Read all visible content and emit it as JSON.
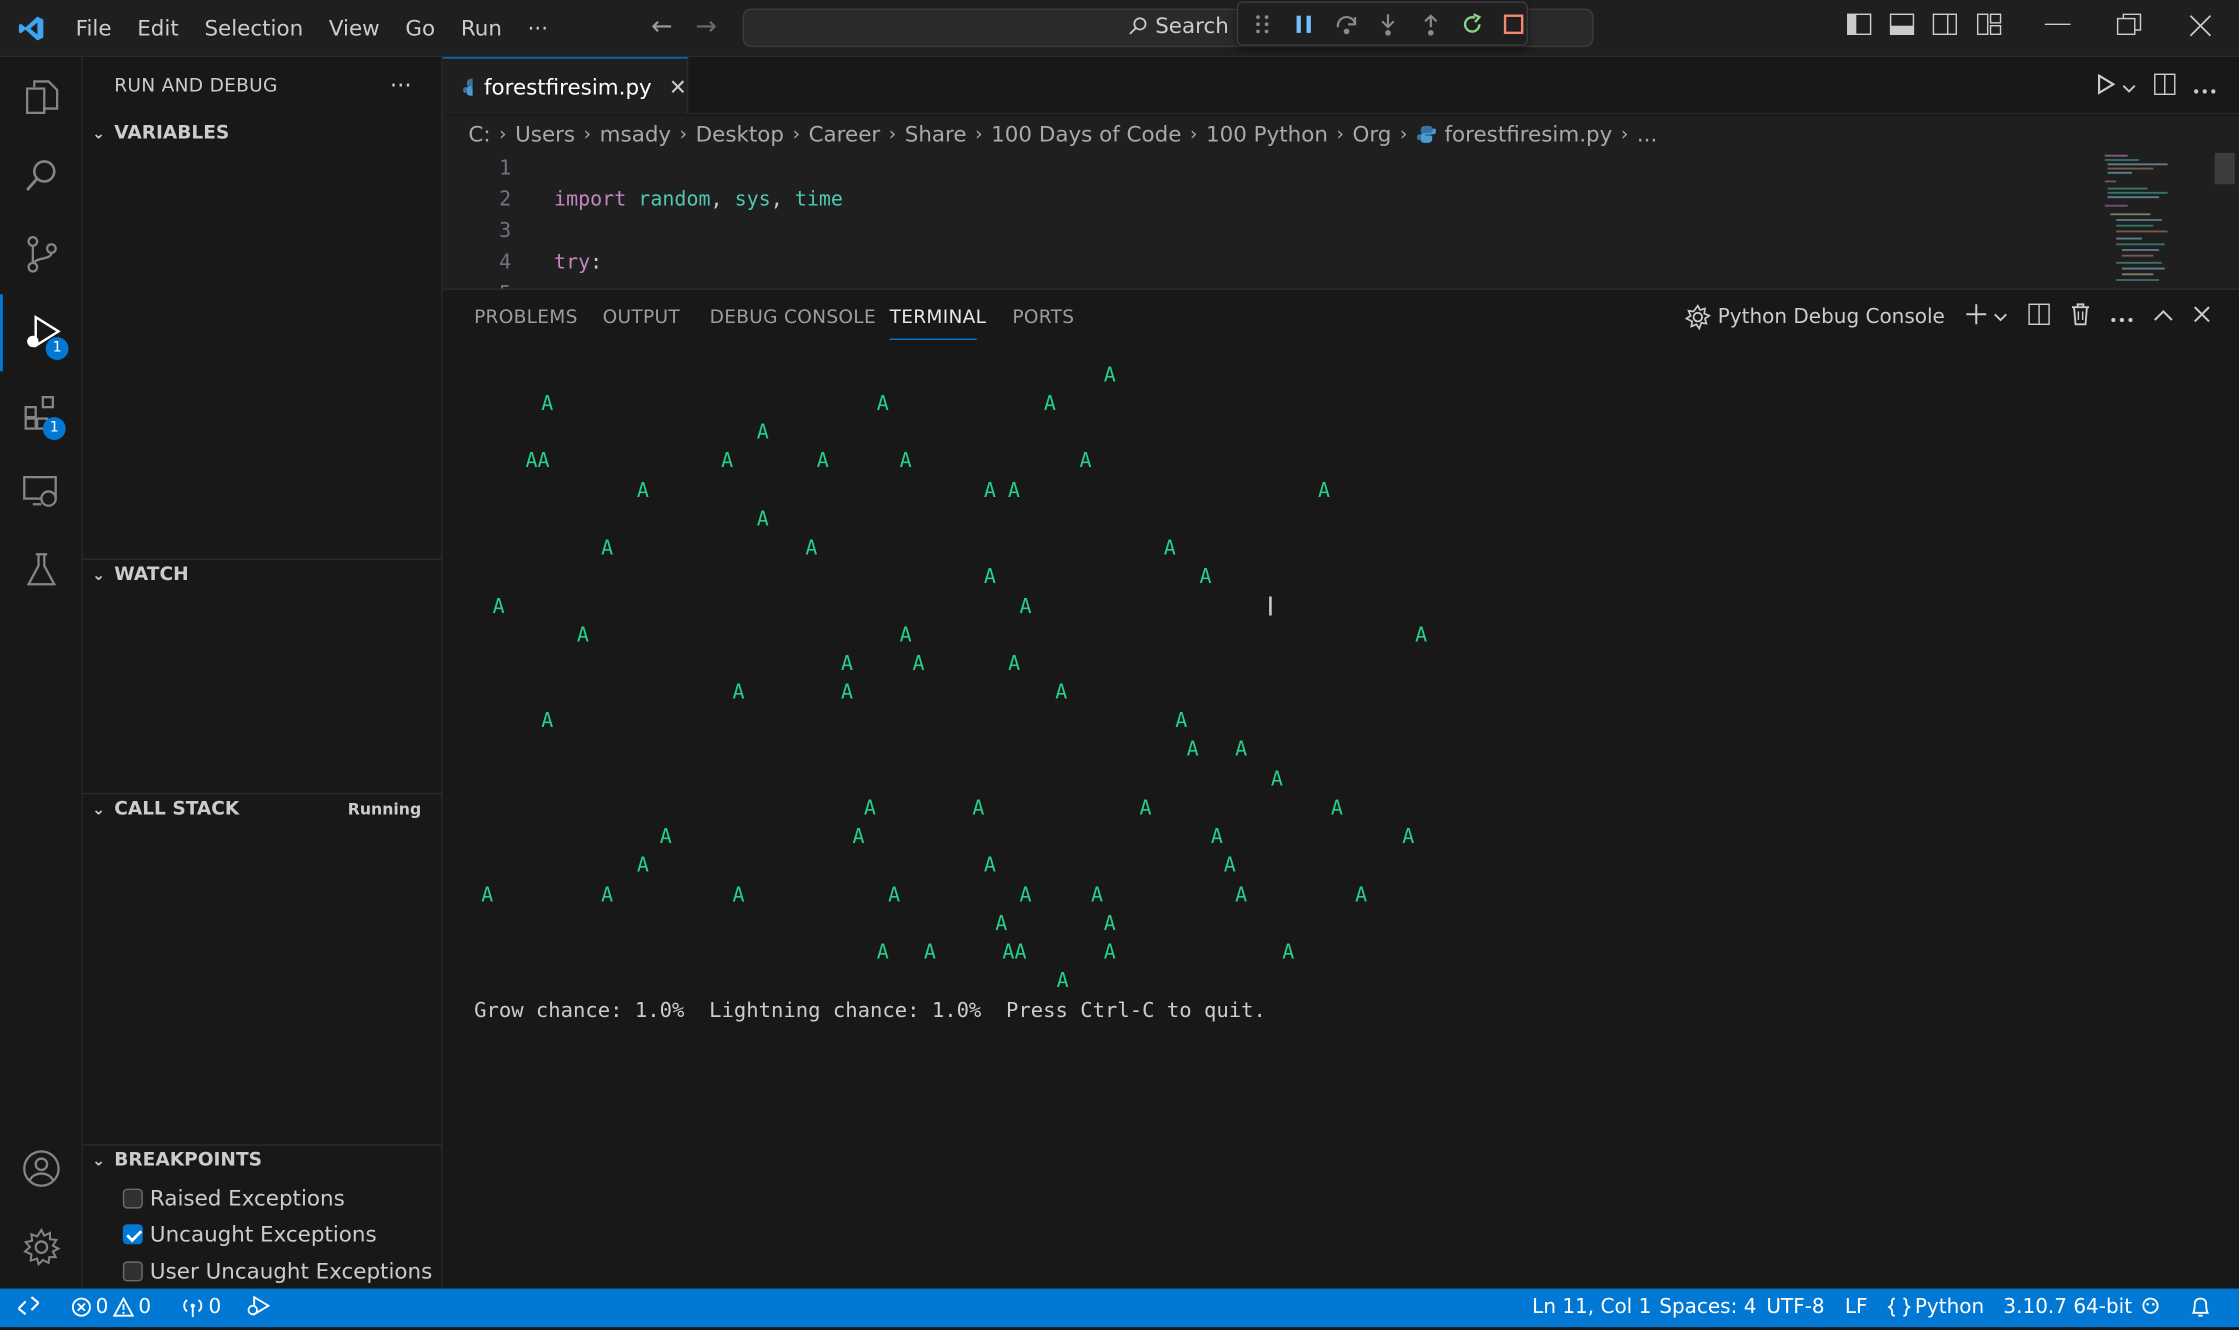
{
  "window": {
    "menu": [
      "File",
      "Edit",
      "Selection",
      "View",
      "Go",
      "Run"
    ],
    "menu_more": "···",
    "search_label": "Search"
  },
  "activity": {
    "run_badge": "1",
    "extensions_badge": "1"
  },
  "sidebar": {
    "title": "RUN AND DEBUG",
    "more": "···",
    "variables": "VARIABLES",
    "watch": "WATCH",
    "call_stack": "CALL STACK",
    "call_stack_status": "Running",
    "breakpoints": "BREAKPOINTS",
    "breakpoint_items": [
      {
        "label": "Raised Exceptions",
        "checked": false
      },
      {
        "label": "Uncaught Exceptions",
        "checked": true
      },
      {
        "label": "User Uncaught Exceptions",
        "checked": false
      }
    ]
  },
  "editor": {
    "tab_name": "forestfiresim.py",
    "breadcrumbs": [
      "C:",
      "Users",
      "msady",
      "Desktop",
      "Career",
      "Share",
      "100 Days of Code",
      "100 Python",
      "Org",
      "forestfiresim.py",
      "..."
    ],
    "lines": [
      {
        "num": "1",
        "tokens": []
      },
      {
        "num": "2",
        "tokens": [
          {
            "t": "import",
            "c": "kw"
          },
          {
            "t": " ",
            "c": "pl"
          },
          {
            "t": "random",
            "c": "id"
          },
          {
            "t": ", ",
            "c": "pl"
          },
          {
            "t": "sys",
            "c": "id"
          },
          {
            "t": ", ",
            "c": "pl"
          },
          {
            "t": "time",
            "c": "id"
          }
        ]
      },
      {
        "num": "3",
        "tokens": []
      },
      {
        "num": "4",
        "tokens": [
          {
            "t": "try",
            "c": "kw"
          },
          {
            "t": ":",
            "c": "pl"
          }
        ]
      },
      {
        "num": "5",
        "tokens": []
      }
    ]
  },
  "panel": {
    "tabs": [
      "PROBLEMS",
      "OUTPUT",
      "DEBUG CONSOLE",
      "TERMINAL",
      "PORTS"
    ],
    "active_tab": "TERMINAL",
    "terminal_name": "Python Debug Console",
    "tree_char": "A",
    "trees": [
      [
        0,
        5,
        "A"
      ],
      [
        1,
        -2,
        "A"
      ],
      [
        1,
        1,
        "A"
      ],
      [
        1,
        3,
        "A"
      ],
      [
        2,
        0,
        "A"
      ],
      [
        3,
        -1,
        "AA"
      ],
      [
        3,
        -1,
        "A"
      ],
      [
        3,
        0,
        "A"
      ],
      [
        3,
        1,
        "A"
      ],
      [
        3,
        2,
        "A"
      ],
      [
        4,
        0,
        "A"
      ],
      [
        4,
        1,
        "A AA"
      ],
      [
        4,
        2,
        "A"
      ],
      [
        5,
        0,
        "A"
      ],
      [
        6,
        0,
        "A"
      ],
      [
        6,
        1,
        "A"
      ],
      [
        6,
        2,
        "A"
      ],
      [
        7,
        0,
        "A"
      ],
      [
        7,
        1,
        "A"
      ],
      [
        8,
        0,
        "A"
      ],
      [
        8,
        1,
        "A"
      ],
      [
        9,
        0,
        "A"
      ],
      [
        9,
        1,
        "A"
      ],
      [
        9,
        2,
        "A"
      ],
      [
        10,
        0,
        "A"
      ],
      [
        10,
        1,
        "A"
      ],
      [
        10,
        2,
        "A"
      ],
      [
        11,
        0,
        "A"
      ],
      [
        11,
        1,
        "A"
      ],
      [
        11,
        2,
        "A"
      ],
      [
        12,
        0,
        "A"
      ],
      [
        13,
        0,
        "A"
      ],
      [
        13,
        1,
        "A"
      ],
      [
        14,
        0,
        "A"
      ],
      [
        15,
        0,
        "A"
      ],
      [
        15,
        1,
        "A"
      ],
      [
        15,
        2,
        "A"
      ],
      [
        15,
        3,
        "A"
      ],
      [
        16,
        0,
        "A"
      ],
      [
        16,
        1,
        "A"
      ],
      [
        16,
        2,
        "A"
      ],
      [
        16,
        3,
        "A"
      ],
      [
        17,
        0,
        "A"
      ],
      [
        17,
        1,
        "A"
      ],
      [
        17,
        2,
        "A"
      ],
      [
        18,
        0,
        "A"
      ],
      [
        18,
        1,
        "A"
      ],
      [
        18,
        2,
        "A"
      ],
      [
        18,
        3,
        "A"
      ],
      [
        18,
        4,
        "A"
      ],
      [
        18,
        5,
        "A"
      ],
      [
        18,
        6,
        "A"
      ],
      [
        18,
        7,
        "A"
      ],
      [
        19,
        0,
        "A"
      ],
      [
        19,
        1,
        "A"
      ],
      [
        20,
        0,
        "A"
      ],
      [
        20,
        1,
        "A"
      ],
      [
        20,
        2,
        "AA"
      ],
      [
        20,
        3,
        "A"
      ],
      [
        20,
        4,
        "A"
      ],
      [
        21,
        0,
        "A"
      ]
    ],
    "status_line": "Grow chance: 1.0%  Lightning chance: 1.0%  Press Ctrl-C to quit."
  },
  "statusbar": {
    "errors": "0",
    "warnings": "0",
    "ports": "0",
    "position": "Ln 11, Col 1",
    "spaces": "Spaces: 4",
    "encoding": "UTF-8",
    "eol": "LF",
    "language": "Python",
    "interpreter": "3.10.7 64-bit"
  },
  "colors": {
    "accent": "#0078d4",
    "tree": "#23d18b",
    "keyword": "#c586c0",
    "identifier": "#4ec9b0"
  }
}
